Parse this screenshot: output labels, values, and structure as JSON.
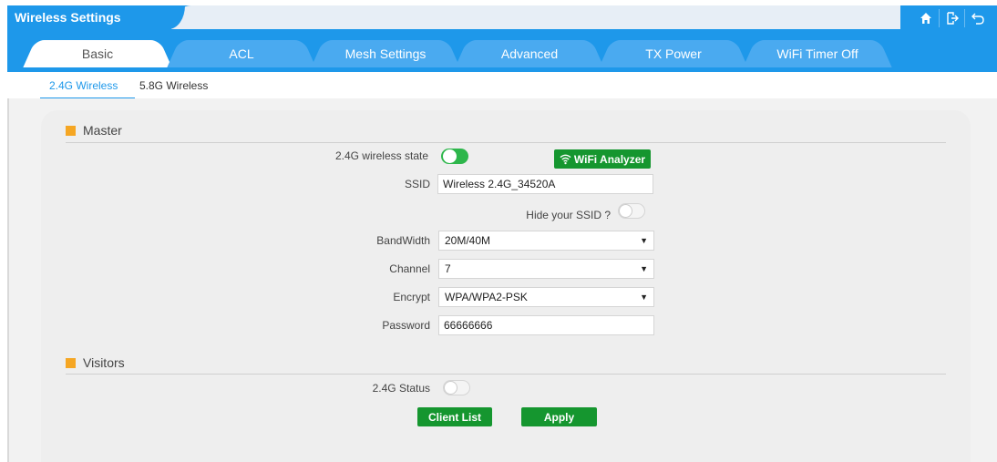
{
  "header": {
    "title": "Wireless Settings",
    "icons": [
      "home-icon",
      "logout-icon",
      "back-icon"
    ],
    "accent_color": "#1e98ea"
  },
  "tabs": [
    {
      "label": "Basic",
      "active": true
    },
    {
      "label": "ACL",
      "active": false
    },
    {
      "label": "Mesh Settings",
      "active": false
    },
    {
      "label": "Advanced",
      "active": false
    },
    {
      "label": "TX Power",
      "active": false
    },
    {
      "label": "WiFi Timer Off",
      "active": false
    }
  ],
  "subtabs": [
    {
      "label": "2.4G Wireless",
      "active": true
    },
    {
      "label": "5.8G Wireless",
      "active": false
    }
  ],
  "master": {
    "title": "Master",
    "state_label": "2.4G wireless state",
    "state_on": true,
    "analyzer_button": "WiFi Analyzer",
    "ssid_label": "SSID",
    "ssid_value": "Wireless 2.4G_34520A",
    "hide_ssid_label": "Hide your SSID ?",
    "hide_ssid_on": false,
    "bandwidth_label": "BandWidth",
    "bandwidth_value": "20M/40M",
    "channel_label": "Channel",
    "channel_value": "7",
    "encrypt_label": "Encrypt",
    "encrypt_value": "WPA/WPA2-PSK",
    "password_label": "Password",
    "password_value": "66666666"
  },
  "visitors": {
    "title": "Visitors",
    "status_label": "2.4G Status",
    "status_on": false
  },
  "actions": {
    "client_list": "Client List",
    "apply": "Apply"
  },
  "colors": {
    "section_marker": "#f5a623",
    "button_green": "#15962f",
    "toggle_on": "#2db64b"
  }
}
